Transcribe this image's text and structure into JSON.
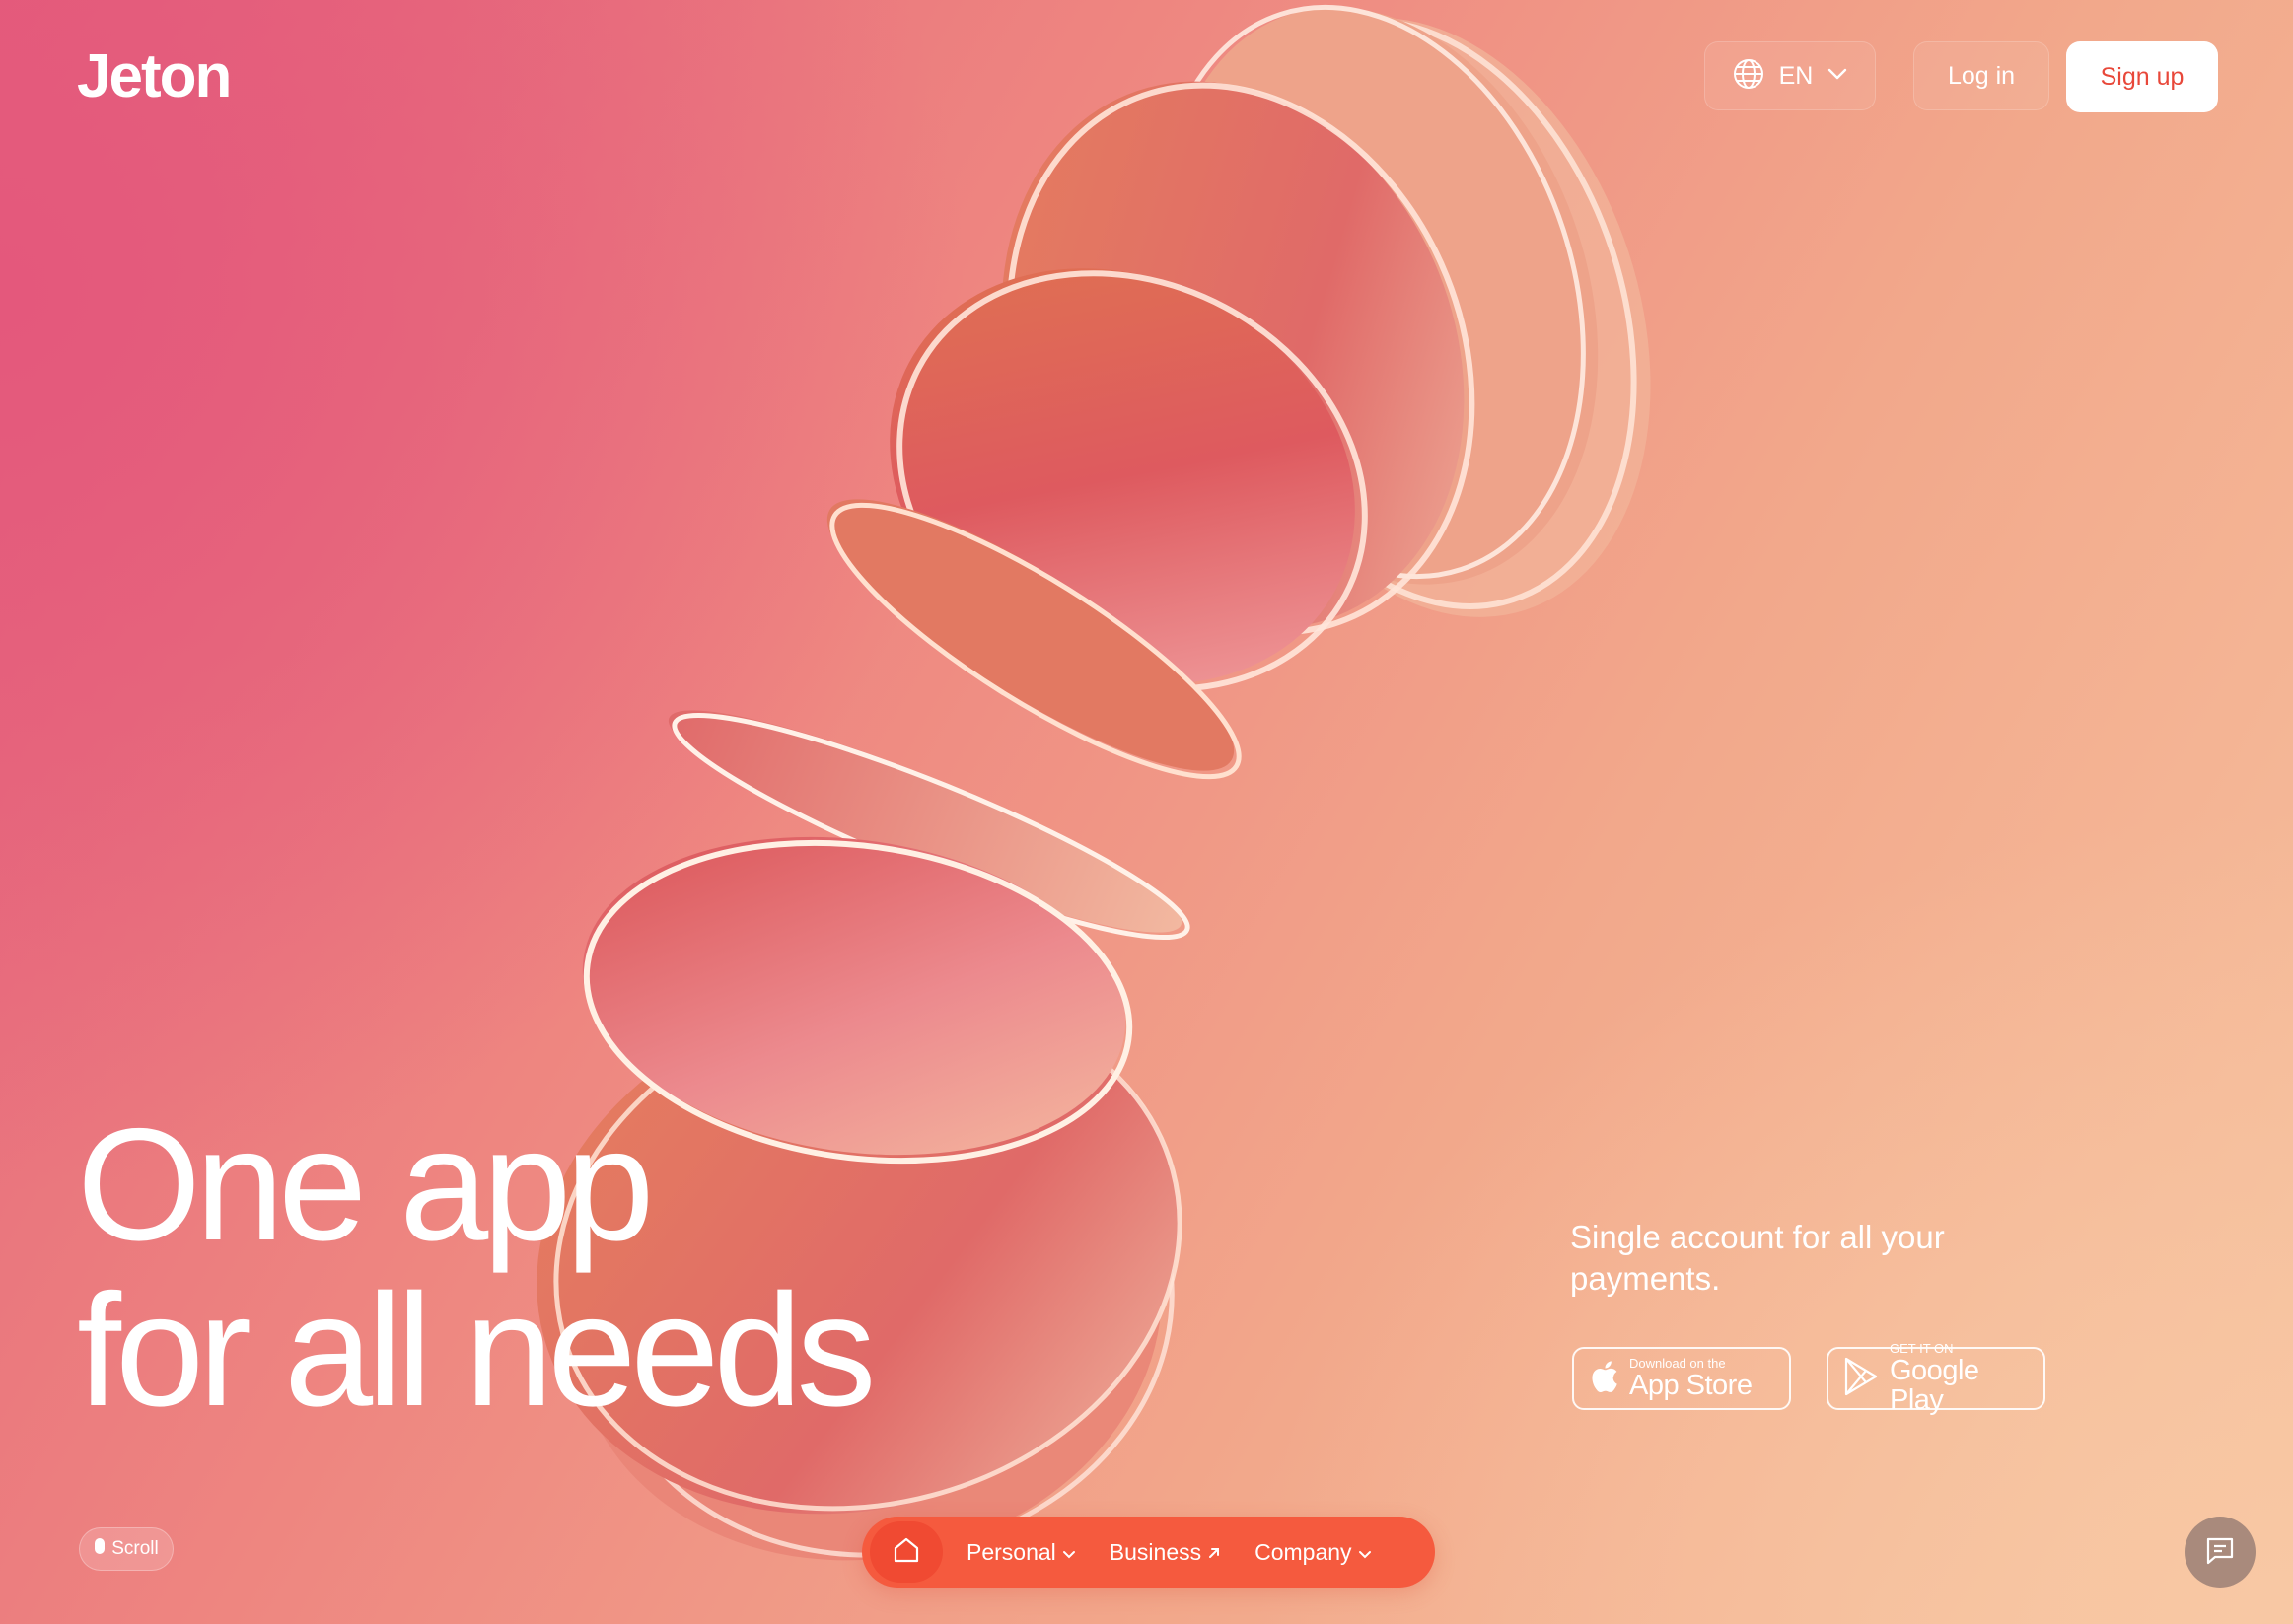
{
  "header": {
    "logo_text": "Jeton",
    "language": {
      "label": "EN",
      "icon": "globe-icon",
      "chevron": "chevron-down-icon"
    },
    "login_label": "Log in",
    "signup_label": "Sign up"
  },
  "hero": {
    "headline_line1": "One app",
    "headline_line2": "for all needs",
    "tagline": "Single account for all your payments."
  },
  "stores": {
    "apple": {
      "small": "Download on the",
      "big": "App Store",
      "icon": "apple-icon"
    },
    "google": {
      "small": "GET IT ON",
      "big": "Google Play",
      "icon": "google-play-icon"
    }
  },
  "bottom": {
    "scroll_label": "Scroll",
    "nav": {
      "home_icon": "home-icon",
      "items": [
        {
          "label": "Personal",
          "icon": "chevron-down-icon"
        },
        {
          "label": "Business",
          "icon": "arrow-up-right-icon"
        },
        {
          "label": "Company",
          "icon": "chevron-down-icon"
        }
      ]
    },
    "chat_icon": "chat-icon"
  },
  "colors": {
    "accent": "#f55a3e",
    "signup_text": "#e8483a",
    "bg_left": "#e35f7a",
    "bg_right": "#f6c19e",
    "chat_bg": "#a98a7c"
  }
}
